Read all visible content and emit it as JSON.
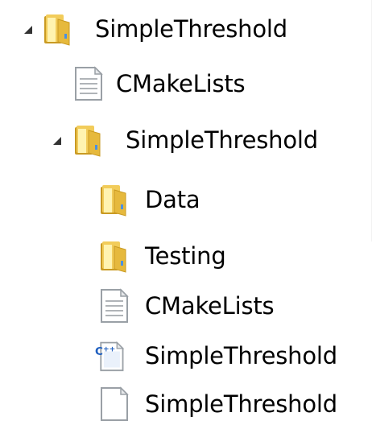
{
  "tree": {
    "nodes": [
      {
        "label": "SimpleThreshold",
        "icon": "folder-icon",
        "expanded": true
      },
      {
        "label": "CMakeLists",
        "icon": "text-file-icon"
      },
      {
        "label": "SimpleThreshold",
        "icon": "folder-icon",
        "expanded": true
      },
      {
        "label": "Data",
        "icon": "folder-icon"
      },
      {
        "label": "Testing",
        "icon": "folder-icon"
      },
      {
        "label": "CMakeLists",
        "icon": "text-file-icon"
      },
      {
        "label": "SimpleThreshold",
        "icon": "cpp-file-icon",
        "badge": "C++"
      },
      {
        "label": "SimpleThreshold",
        "icon": "blank-file-icon"
      }
    ]
  },
  "colors": {
    "folder_light": "#fff3b0",
    "folder_mid": "#f2cc5a",
    "folder_dark": "#c99a22",
    "file_border": "#9aa0a6",
    "cpp_blue": "#1f5fbf",
    "toggle": "#333333"
  }
}
